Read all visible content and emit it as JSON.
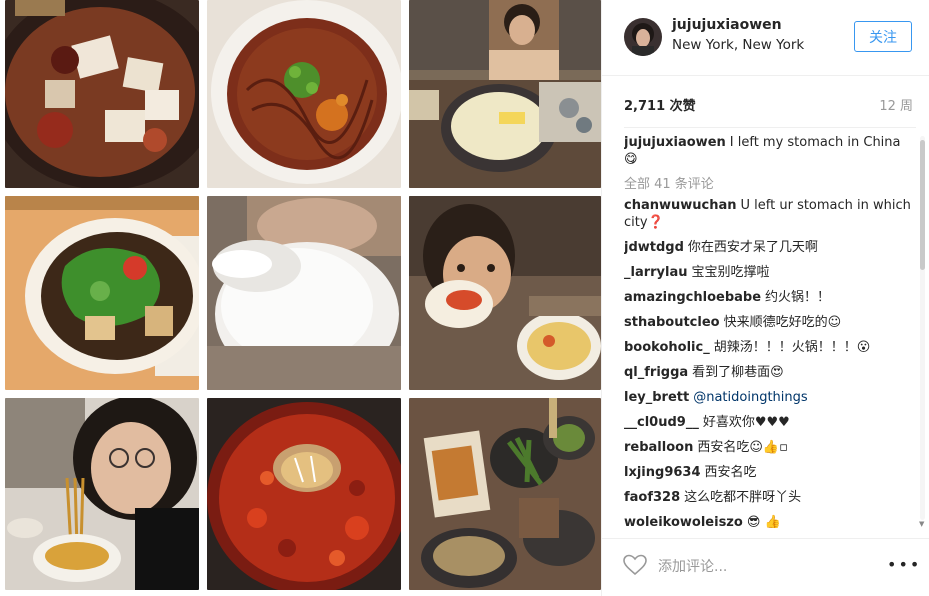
{
  "post": {
    "username": "jujujuxiaowen",
    "location": "New York, New York",
    "follow_label": "关注",
    "likes": "2,711 次赞",
    "time_ago": "12 周",
    "caption_text": "I left my stomach in China 😋",
    "view_all": "全部 41 条评论",
    "add_comment_placeholder": "添加评论...",
    "more_label": "•••",
    "icons": {
      "heart": "heart-outline-icon",
      "more": "more-dots-icon",
      "scroll": "scroll-down-arrow-icon"
    },
    "colors": {
      "accent": "#3897f0",
      "muted": "#999999"
    }
  },
  "comments": [
    {
      "user": "chanwuwuchan",
      "text": "U left ur stomach in which city❓"
    },
    {
      "user": "jdwtdgd",
      "text": "你在西安才呆了几天啊"
    },
    {
      "user": "_larrylau",
      "text": "宝宝别吃撑啦"
    },
    {
      "user": "amazingchloebabe",
      "text": "约火锅！！"
    },
    {
      "user": "sthaboutcleo",
      "text": "快来顺德吃好吃的☺"
    },
    {
      "user": "bookoholic_",
      "text": "胡辣汤！！！火锅！！！😮"
    },
    {
      "user": "ql_frigga",
      "text": "看到了柳巷面😍"
    },
    {
      "user": "ley_brett",
      "text": "@natidoingthings"
    },
    {
      "user": "__cl0ud9__",
      "text": "好喜欢你♥♥♥"
    },
    {
      "user": "reballoon",
      "text": "西安名吃☺👍▫"
    },
    {
      "user": "lxjing9634",
      "text": "西安名吃"
    },
    {
      "user": "faof328",
      "text": "这么吃都不胖呀丫头"
    },
    {
      "user": "woleikowoleiszo",
      "text": "😎 👍"
    }
  ]
}
